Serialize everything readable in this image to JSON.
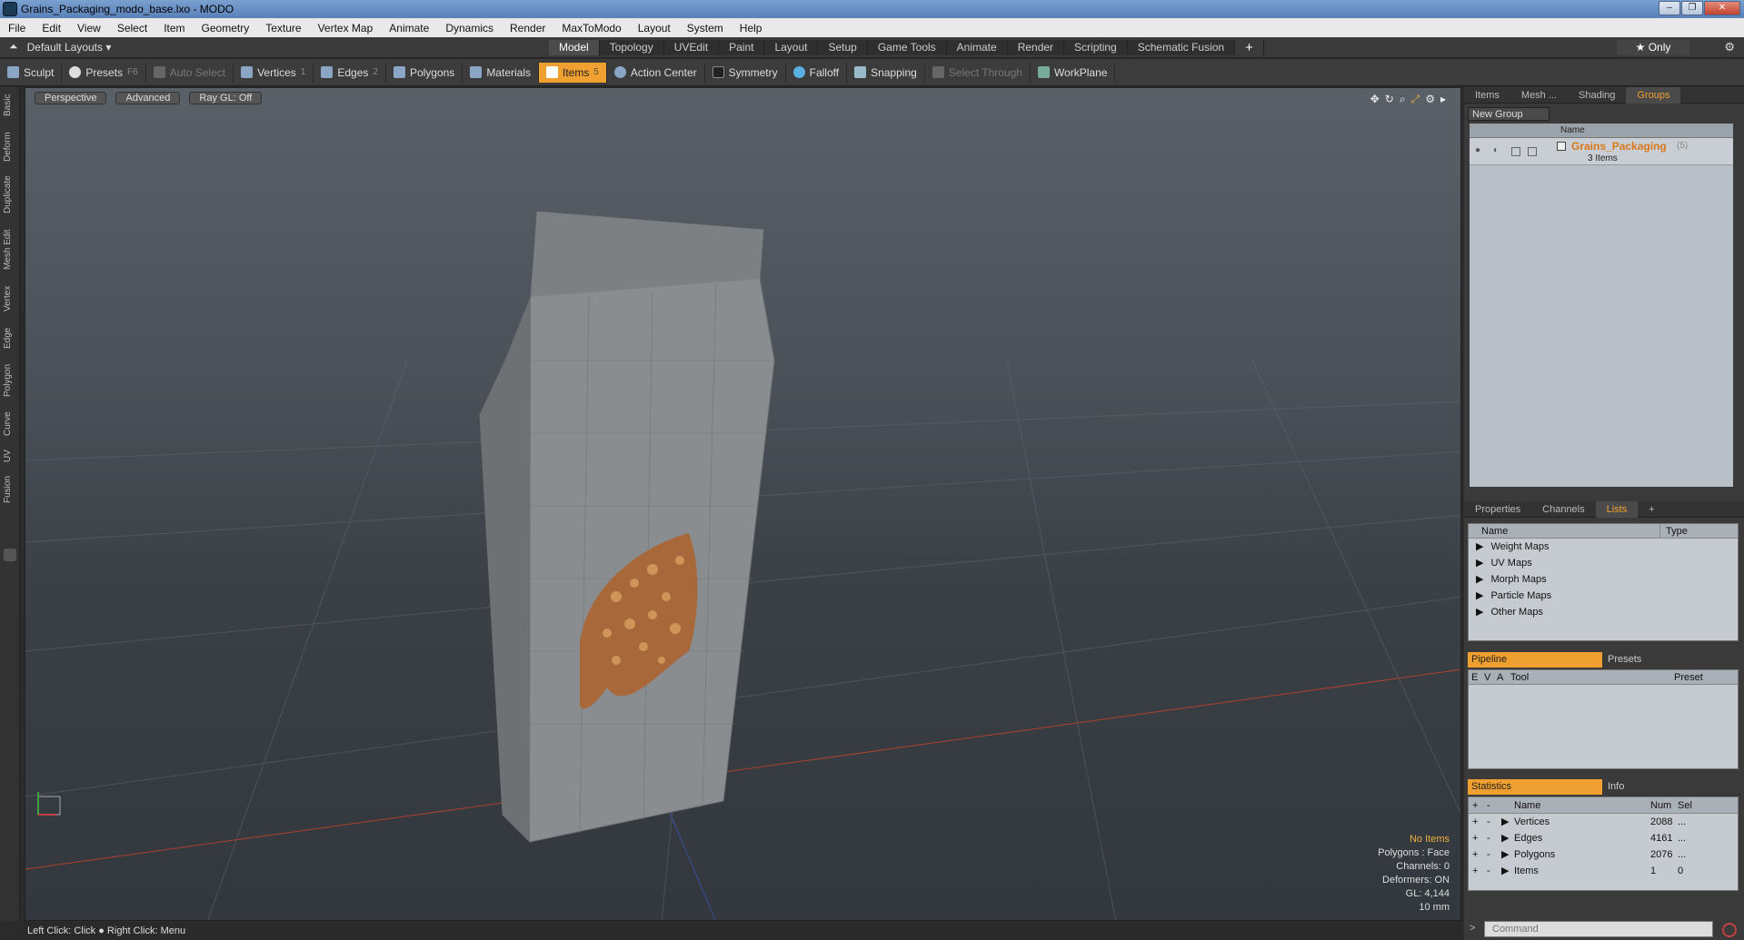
{
  "window": {
    "title": "Grains_Packaging_modo_base.lxo - MODO"
  },
  "menu": [
    "File",
    "Edit",
    "View",
    "Select",
    "Item",
    "Geometry",
    "Texture",
    "Vertex Map",
    "Animate",
    "Dynamics",
    "Render",
    "MaxToModo",
    "Layout",
    "System",
    "Help"
  ],
  "layout_selector": "Default Layouts ▾",
  "mode_tabs": [
    "Model",
    "Topology",
    "UVEdit",
    "Paint",
    "Layout",
    "Setup",
    "Game Tools",
    "Animate",
    "Render",
    "Scripting",
    "Schematic Fusion"
  ],
  "active_mode_tab": "Model",
  "only_label": "★ Only",
  "toolbar": {
    "sculpt": "Sculpt",
    "presets": "Presets",
    "presets_key": "F6",
    "auto_select": "Auto Select",
    "vertices": "Vertices",
    "vertices_key": "1",
    "edges": "Edges",
    "edges_key": "2",
    "polygons": "Polygons",
    "materials": "Materials",
    "items": "Items",
    "items_key": "5",
    "action_center": "Action Center",
    "symmetry": "Symmetry",
    "falloff": "Falloff",
    "snapping": "Snapping",
    "select_through": "Select Through",
    "workplane": "WorkPlane"
  },
  "left_tabs": [
    "Basic",
    "Deform",
    "Duplicate",
    "Mesh Edit",
    "Vertex",
    "Edge",
    "Polygon",
    "Curve",
    "UV",
    "Fusion"
  ],
  "viewport": {
    "view_label": "Perspective",
    "style_label": "Advanced",
    "raygl_label": "Ray GL: Off",
    "stats": {
      "items": "No Items",
      "polygons": "Polygons : Face",
      "channels": "Channels: 0",
      "deformers": "Deformers: ON",
      "gl": "GL: 4,144",
      "scale": "10 mm"
    }
  },
  "status_text": "Left Click: Click ● Right Click: Menu",
  "right_top_tabs": [
    "Items",
    "Mesh ...",
    "Shading",
    "Groups"
  ],
  "active_right_top_tab": "Groups",
  "new_group_label": "New Group",
  "groups": {
    "name_header": "Name",
    "group_name": "Grains_Packaging",
    "group_count": "(5)",
    "group_sub": "3 Items"
  },
  "props_tabs": [
    "Properties",
    "Channels",
    "Lists"
  ],
  "active_props_tab": "Lists",
  "lists": {
    "name_header": "Name",
    "type_header": "Type",
    "items": [
      "Weight Maps",
      "UV Maps",
      "Morph Maps",
      "Particle Maps",
      "Other Maps"
    ]
  },
  "pipeline": {
    "tab_pipeline": "Pipeline",
    "tab_presets": "Presets",
    "headers": [
      "E",
      "V",
      "A",
      "Tool",
      "Preset"
    ]
  },
  "statistics": {
    "tab_statistics": "Statistics",
    "tab_info": "Info",
    "headers": [
      "+",
      "-",
      "Name",
      "Num",
      "Sel"
    ],
    "rows": [
      {
        "name": "Vertices",
        "num": "2088",
        "sel": "..."
      },
      {
        "name": "Edges",
        "num": "4161",
        "sel": "..."
      },
      {
        "name": "Polygons",
        "num": "2076",
        "sel": "..."
      },
      {
        "name": "Items",
        "num": "1",
        "sel": "0"
      }
    ]
  },
  "command_placeholder": "Command",
  "colors": {
    "accent": "#f0a030",
    "group_name": "#d9781a"
  }
}
